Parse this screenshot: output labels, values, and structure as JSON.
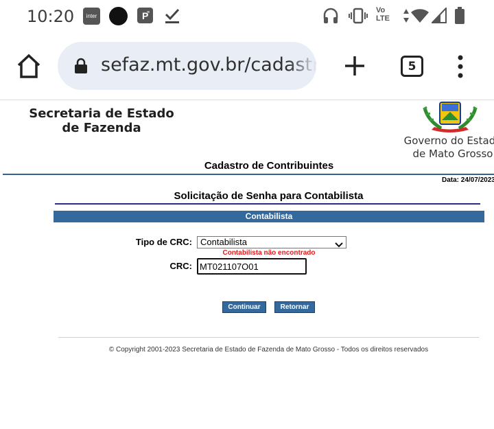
{
  "status_bar": {
    "time": "10:20",
    "inter_label": "inter",
    "icons": [
      "inter-app-icon",
      "circle-notification-icon",
      "payment-app-icon",
      "download-done-icon",
      "headphones-icon",
      "vibrate-icon",
      "volte-icon",
      "data-arrows-icon",
      "wifi-icon",
      "signal-icon",
      "battery-icon"
    ],
    "volte_top": "Vo",
    "volte_bottom": "LTE"
  },
  "browser": {
    "url": "sefaz.mt.gov.br/cadastro",
    "tab_count": "5",
    "icons": [
      "home-icon",
      "lock-icon",
      "plus-icon",
      "tabs-icon",
      "more-vert-icon"
    ]
  },
  "header": {
    "org_line1": "Secretaria de Estado",
    "org_line2": "de Fazenda",
    "gov_line1": "Governo do Estado",
    "gov_line2": "de Mato Grosso",
    "page_title": "Cadastro de Contribuintes",
    "date": "Data: 24/07/2023"
  },
  "form": {
    "title": "Solicitação de Senha para Contabilista",
    "section": "Contabilista",
    "crc_type_label": "Tipo de CRC:",
    "crc_type_value": "Contabilista",
    "error": "Contabilista não encontrado",
    "crc_label": "CRC:",
    "crc_value": "MT021107O01",
    "continue_label": "Continuar",
    "return_label": "Retornar"
  },
  "footer": {
    "copyright": "© Copyright 2001-2023 Secretaria de Estado de Fazenda de Mato Grosso - Todos os direitos reservados"
  },
  "colors": {
    "section_blue": "#33699c",
    "error_red": "#e3191a",
    "omnibox_bg": "#e9eef6",
    "title_rule": "#2a2a8a"
  }
}
